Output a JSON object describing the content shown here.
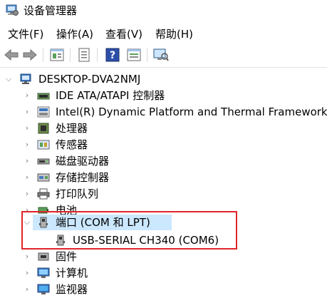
{
  "window": {
    "title": "设备管理器"
  },
  "menu": [
    {
      "label": "文件(F)"
    },
    {
      "label": "操作(A)"
    },
    {
      "label": "查看(V)"
    },
    {
      "label": "帮助(H)"
    }
  ],
  "toolbar": {
    "buttons": [
      "back-arrow-icon",
      "forward-arrow-icon",
      "properties-icon",
      "update-driver-icon",
      "help-icon",
      "view-icon",
      "scan-hardware-icon"
    ]
  },
  "tree": {
    "root": {
      "label": "DESKTOP-DVA2NMJ"
    },
    "items": [
      {
        "label": "IDE ATA/ATAPI 控制器",
        "icon": "ide-controller-icon"
      },
      {
        "label": "Intel(R) Dynamic Platform and Thermal Framework",
        "icon": "intel-framework-icon"
      },
      {
        "label": "处理器",
        "icon": "processor-icon"
      },
      {
        "label": "传感器",
        "icon": "sensor-icon"
      },
      {
        "label": "磁盘驱动器",
        "icon": "disk-drive-icon"
      },
      {
        "label": "存储控制器",
        "icon": "storage-controller-icon"
      },
      {
        "label": "打印队列",
        "icon": "print-queue-icon"
      },
      {
        "label": "电池",
        "icon": "battery-icon"
      },
      {
        "label": "端口 (COM 和 LPT)",
        "icon": "port-icon",
        "expanded": true,
        "children": [
          {
            "label": "USB-SERIAL CH340 (COM6)",
            "icon": "port-icon"
          }
        ]
      },
      {
        "label": "固件",
        "icon": "firmware-icon"
      },
      {
        "label": "计算机",
        "icon": "computer-icon"
      },
      {
        "label": "监视器",
        "icon": "monitor-icon"
      }
    ]
  },
  "colors": {
    "selection": "#cce8ff",
    "highlight_border": "#e0252a"
  }
}
